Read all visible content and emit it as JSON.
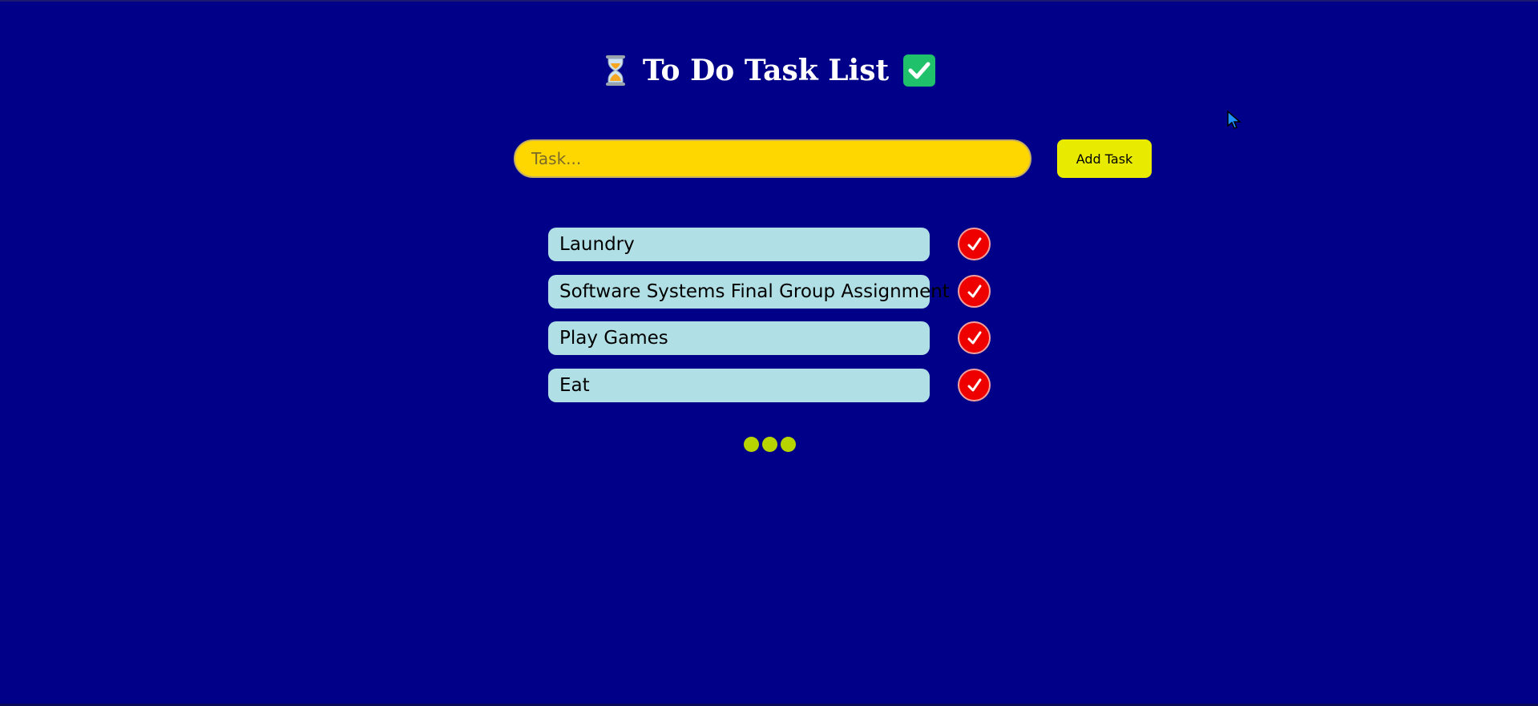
{
  "header": {
    "title": "To Do Task List",
    "leading_icon": "hourglass-icon",
    "trailing_icon": "check-mark-button-icon"
  },
  "task_input": {
    "placeholder": "Task...",
    "value": ""
  },
  "add_button": {
    "label": "Add Task"
  },
  "tasks": [
    {
      "label": "Laundry"
    },
    {
      "label": "Software Systems Final Group Assignment"
    },
    {
      "label": "Play Games"
    },
    {
      "label": "Eat"
    }
  ],
  "complete_icon": "check-icon",
  "colors": {
    "background": "#000088",
    "input_bg": "#ffd700",
    "button_bg": "#e8ea00",
    "task_bg": "#b0e0e6",
    "complete_bg": "#ee0000",
    "dots": "#b8d400"
  }
}
